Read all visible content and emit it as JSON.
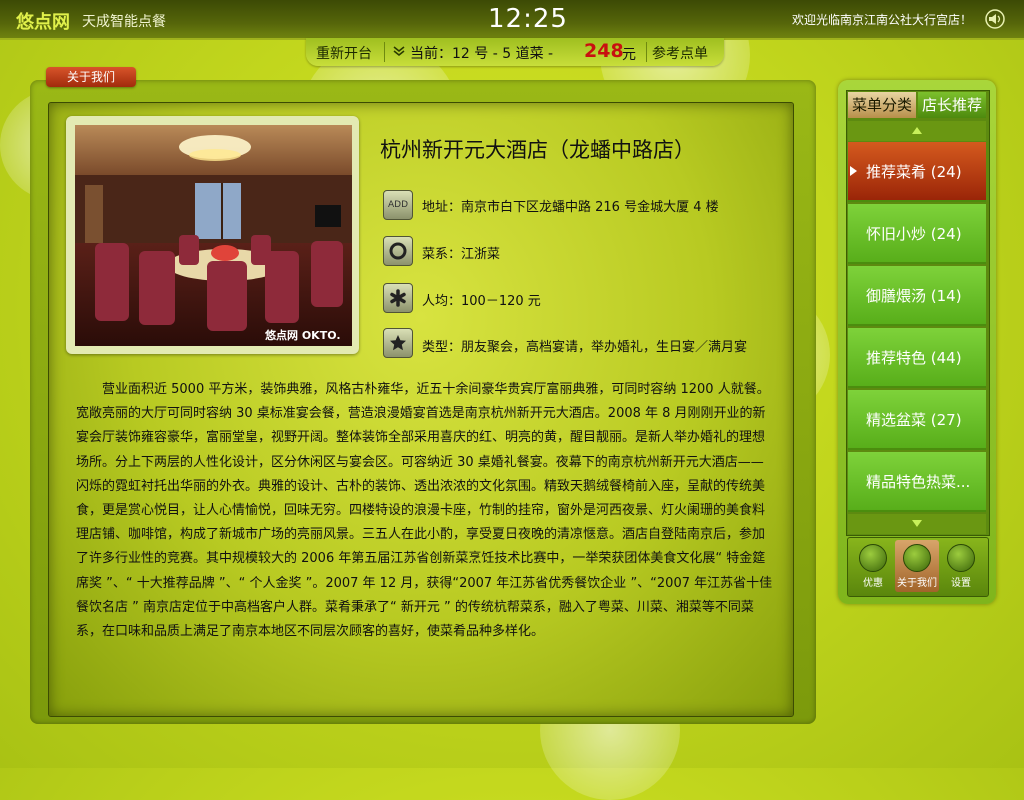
{
  "header": {
    "brand": "悠点网",
    "tagline": "天成智能点餐",
    "clock": "12:25",
    "welcome": "欢迎光临南京江南公社大行宫店！"
  },
  "order_bar": {
    "restart_label": "重新开台",
    "order_info": "当前：12 号 - 5 道菜 -",
    "price": "248",
    "unit": "元",
    "reference_label": "参考点单"
  },
  "about_tab": "关于我们",
  "restaurant": {
    "name": "杭州新开元大酒店（龙蟠中路店）",
    "photo_watermark": "悠点网 OKTO.",
    "info": [
      {
        "icon": "address-icon",
        "label": "ADD",
        "text": "地址：南京市白下区龙蟠中路 216 号金城大厦 4 楼"
      },
      {
        "icon": "cuisine-icon",
        "text": "菜系：江浙菜"
      },
      {
        "icon": "asterisk-icon",
        "text": "人均：100－120 元"
      },
      {
        "icon": "star-icon",
        "text": "类型：朋友聚会，高档宴请，举办婚礼，生日宴／满月宴"
      }
    ],
    "description": "营业面积近 5000 平方米，装饰典雅，风格古朴雍华，近五十余间豪华贵宾厅富丽典雅，可同时容纳 1200 人就餐。宽敞亮丽的大厅可同时容纳 30 桌标准宴会餐，营造浪漫婚宴首选是南京杭州新开元大酒店。2008 年 8 月刚刚开业的新宴会厅装饰雍容豪华，富丽堂皇，视野开阔。整体装饰全部采用喜庆的红、明亮的黄，醒目靓丽。是新人举办婚礼的理想场所。分上下两层的人性化设计，区分休闲区与宴会区。可容纳近 30 桌婚礼餐宴。夜幕下的南京杭州新开元大酒店——闪烁的霓虹衬托出华丽的外衣。典雅的设计、古朴的装饰、透出浓浓的文化氛围。精致天鹅绒餐椅前入座，呈献的传统美食，更是赏心悦目，让人心情愉悦，回味无穷。四楼特设的浪漫卡座，竹制的挂帘，窗外是河西夜景、灯火阑珊的美食料理店铺、咖啡馆，构成了新城市广场的亮丽风景。三五人在此小酌，享受夏日夜晚的清凉惬意。酒店自登陆南京后，参加了许多行业性的竞赛。其中规模较大的 2006 年第五届江苏省创新菜烹饪技术比赛中，一举荣获团体美食文化展“ 特金筵席奖 ”、“ 十大推荐品牌 ”、“ 个人金奖 ”。2007 年 12 月，获得“2007 年江苏省优秀餐饮企业 ”、“2007 年江苏省十佳餐饮名店 ” 南京店定位于中高档客户人群。菜肴秉承了“ 新开元 ” 的传统杭帮菜系，融入了粤菜、川菜、湘菜等不同菜系，在口味和品质上满足了南京本地区不同层次顾客的喜好，使菜肴品种多样化。"
  },
  "sidebar": {
    "tabs": [
      "菜单分类",
      "店长推荐"
    ],
    "categories": [
      {
        "label": "推荐菜肴 (24)",
        "active": true
      },
      {
        "label": "怀旧小炒 (24)",
        "active": false
      },
      {
        "label": "御膳煨汤 (14)",
        "active": false
      },
      {
        "label": "推荐特色 (44)",
        "active": false
      },
      {
        "label": "精选盆菜 (27)",
        "active": false
      },
      {
        "label": "精品特色热菜...",
        "active": false
      }
    ],
    "bottom_buttons": [
      {
        "label": "优惠",
        "icon": "discount-icon"
      },
      {
        "label": "关于我们",
        "icon": "about-icon"
      },
      {
        "label": "设置",
        "icon": "settings-icon"
      }
    ]
  },
  "colors": {
    "background": "#c4d81e",
    "accent_red": "#c81010",
    "active_category": "#9a2508",
    "sidebar_green": "#58ae1a"
  }
}
